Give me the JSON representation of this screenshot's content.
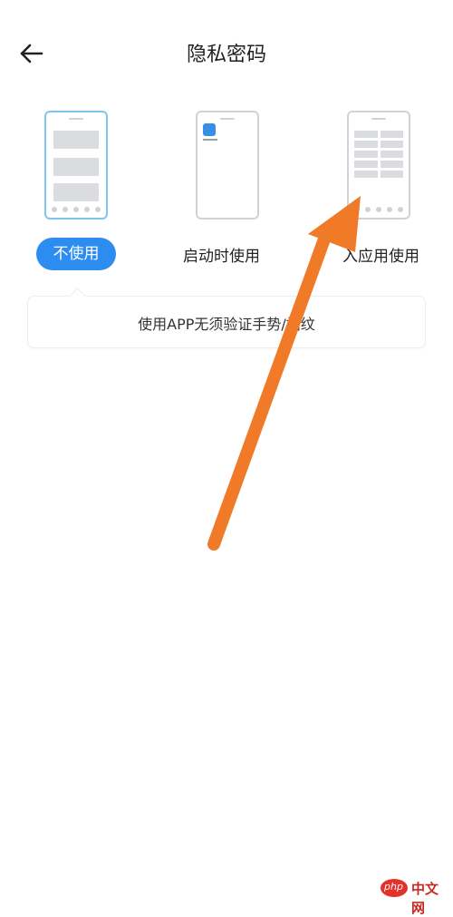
{
  "header": {
    "title": "隐私密码",
    "back_icon": "arrow-left-icon"
  },
  "options": [
    {
      "label": "不使用",
      "selected": true
    },
    {
      "label": "启动时使用",
      "selected": false
    },
    {
      "label": "入应用使用",
      "selected": false
    }
  ],
  "info": {
    "text": "使用APP无须验证手势/指纹"
  },
  "watermark": {
    "logo_text": "php",
    "text": "中文网"
  },
  "colors": {
    "accent": "#2d8cf0",
    "arrow": "#f07a28",
    "watermark": "#e2322a"
  }
}
